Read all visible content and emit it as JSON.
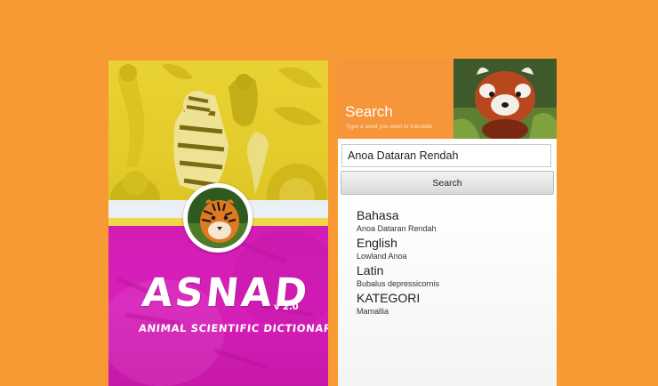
{
  "splash": {
    "logo": "ASNAD",
    "version": "v 2.0",
    "tagline": "ANIMAL SCIENTIFIC DICTIONARY",
    "colors": {
      "top": "#E6CE2E",
      "bottom": "#D51CB6"
    }
  },
  "app": {
    "header": {
      "title": "Search",
      "subtitle": "Type a word you want to translate",
      "photo_icon": "red-panda-photo"
    },
    "search": {
      "value": "Anoa Dataran Rendah",
      "button_label": "Search"
    },
    "results": [
      {
        "label": "Bahasa",
        "value": "Anoa Dataran Rendah"
      },
      {
        "label": "English",
        "value": "Lowland Anoa"
      },
      {
        "label": "Latin",
        "value": "Bubalus depressicornis"
      },
      {
        "label": "KATEGORI",
        "value": "Mamallia"
      }
    ],
    "colors": {
      "accent": "#F7953A",
      "background": "#F89A33"
    }
  }
}
